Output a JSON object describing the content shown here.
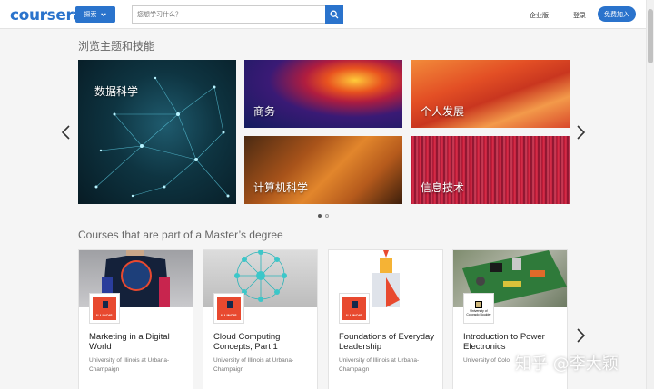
{
  "header": {
    "logo": "coursera",
    "explore_label": "探索",
    "search_placeholder": "您想学习什么？",
    "enterprise_label": "企业版",
    "login_label": "登录",
    "join_label": "免费加入"
  },
  "topics_section": {
    "title": "浏览主题和技能",
    "topics": [
      {
        "label": "数据科学"
      },
      {
        "label": "商务"
      },
      {
        "label": "个人发展"
      },
      {
        "label": "计算机科学"
      },
      {
        "label": "信息技术"
      }
    ],
    "pagination": {
      "pages": 2,
      "current": 1
    }
  },
  "courses_section": {
    "title": "Courses that are part of a Master’s degree",
    "courses": [
      {
        "title": "Marketing in a Digital World",
        "university": "University of Illinois at Urbana-Champaign",
        "badge_text": "ILLINOIS"
      },
      {
        "title": "Cloud Computing Concepts, Part 1",
        "university": "University of Illinois at Urbana-Champaign",
        "badge_text": "ILLINOIS"
      },
      {
        "title": "Foundations of Everyday Leadership",
        "university": "University of Illinois at Urbana-Champaign",
        "badge_text": "ILLINOIS"
      },
      {
        "title": "Introduction to Power Electronics",
        "university": "University of Colo",
        "badge_text": "University of Colorado Boulder"
      }
    ]
  },
  "watermark": "知乎 @李大颖",
  "colors": {
    "brand": "#2a73cc",
    "illinois_orange": "#e8492f"
  }
}
